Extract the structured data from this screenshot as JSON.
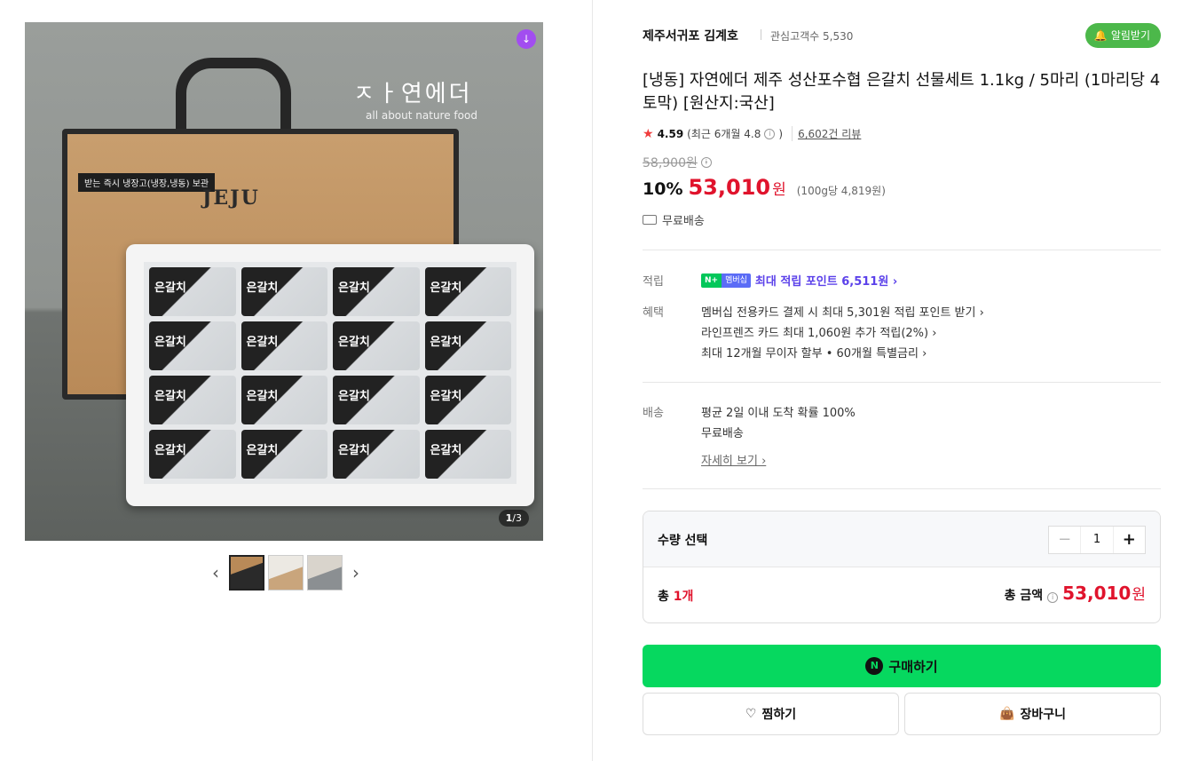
{
  "gallery": {
    "brand_logo": "ㅈㅏ연에더",
    "brand_sub": "all about nature food",
    "bag_label": "받는 즉시 냉장고(냉장,냉동) 보관",
    "bag_brand": "JEJU",
    "pack_label": "은갈치",
    "counter_current": "1",
    "counter_total": "/3"
  },
  "seller": {
    "name": "제주서귀포 김계호",
    "fans": "관심고객수 5,530",
    "alarm_label": "알림받기"
  },
  "product": {
    "title": "[냉동] 자연에더 제주 성산포수협 은갈치 선물세트 1.1kg / 5마리 (1마리당 4토막) [원산지:국산]",
    "rating": "4.59",
    "recent_rating": "(최근 6개월 4.8",
    "recent_rating_close": ")",
    "review_count": "6,602건 리뷰",
    "original_price": "58,900원",
    "discount": "10%",
    "price": "53,010",
    "won": "원",
    "unit_price": "(100g당 4,819원)",
    "shipping_fee": "무료배송"
  },
  "points": {
    "label": "적립",
    "badge_n": "N+",
    "badge_m": "멤버십",
    "text": "최대 적립 포인트 6,511원 ›"
  },
  "benefits": {
    "label": "혜택",
    "items": [
      "멤버십 전용카드 결제 시 최대 5,301원 적립 포인트 받기 ›",
      "라인프렌즈 카드 최대 1,060원 추가 적립(2%) ›",
      "최대 12개월 무이자 할부 • 60개월 특별금리 ›"
    ]
  },
  "delivery": {
    "label": "배송",
    "line1": "평균 2일 이내 도착 확률 100%",
    "line2": "무료배송",
    "detail_link": "자세히 보기 ›"
  },
  "quantity": {
    "title": "수량 선택",
    "minus": "−",
    "value": "1",
    "plus": "+",
    "total_prefix": "총 ",
    "total_count": "1개",
    "total_label": "총 금액",
    "total_price": "53,010",
    "total_won": "원"
  },
  "actions": {
    "buy_label": "구매하기",
    "npay_symbol": "N",
    "wish_label": "찜하기",
    "cart_label": "장바구니"
  },
  "colors": {
    "buy_green": "#06d85f",
    "price_red": "#e0132c",
    "point_purple": "#5b41ea",
    "alarm_green": "#4cb84a"
  }
}
